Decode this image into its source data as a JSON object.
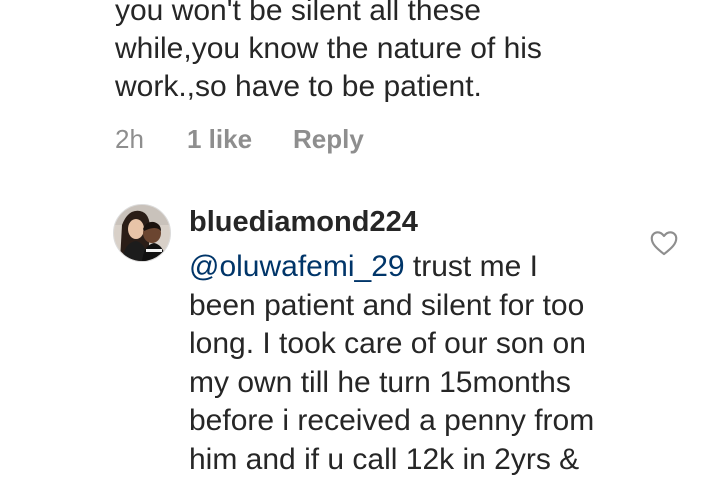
{
  "previous_comment": {
    "text_lines": [
      "you won't be silent all these",
      "while,you know the nature of his",
      "work.,so have to be patient."
    ],
    "time": "2h",
    "likes": "1 like",
    "reply_label": "Reply"
  },
  "reply": {
    "username": "bluediamond224",
    "mention": "@oluwafemi_29",
    "first_line_rest": " trust me I",
    "text_lines": [
      "been patient and silent for too",
      "long. I took care of our son on",
      "my own till he turn 15months",
      "before i received a penny from",
      "him and if u call 12k in 2yrs &"
    ],
    "like_icon": "heart-outline-icon"
  }
}
